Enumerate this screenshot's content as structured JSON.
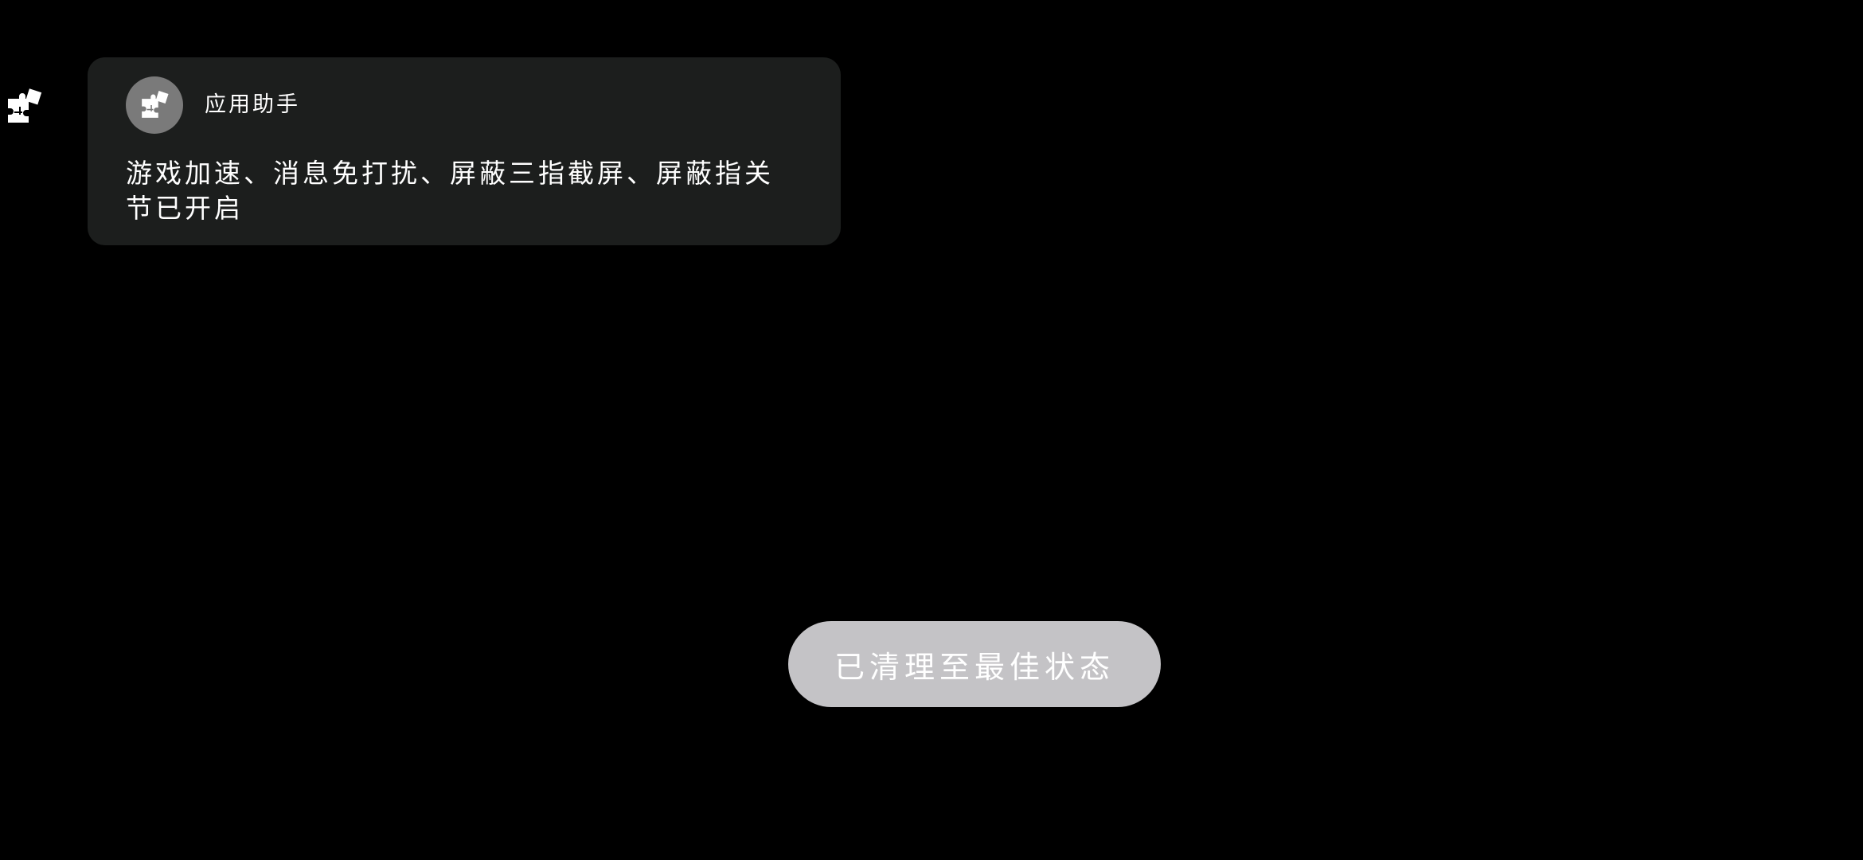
{
  "side_indicator": {
    "icon": "puzzle-icon"
  },
  "notification": {
    "app_icon": "puzzle-icon",
    "app_name": "应用助手",
    "message": "游戏加速、消息免打扰、屏蔽三指截屏、屏蔽指关节已开启",
    "card_color": "#1c1e1d",
    "icon_bg_color": "#7a7a7a"
  },
  "status_button": {
    "label": "已清理至最佳状态",
    "color": "#c4c3c6"
  }
}
